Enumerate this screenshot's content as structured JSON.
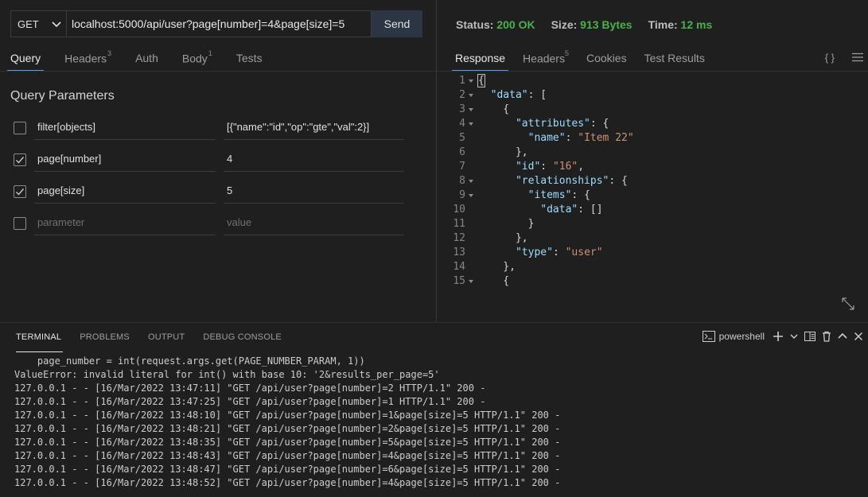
{
  "request": {
    "method": "GET",
    "url": "localhost:5000/api/user?page[number]=4&page[size]=5",
    "send_label": "Send",
    "tabs": [
      {
        "label": "Query",
        "count": ""
      },
      {
        "label": "Headers",
        "count": "3"
      },
      {
        "label": "Auth",
        "count": ""
      },
      {
        "label": "Body",
        "count": "1"
      },
      {
        "label": "Tests",
        "count": ""
      }
    ],
    "query_title": "Query Parameters",
    "params": [
      {
        "key": "filter[objects]",
        "value": "[{\"name\":\"id\",\"op\":\"gte\",\"val\":2}]",
        "checked": false
      },
      {
        "key": "page[number]",
        "value": "4",
        "checked": true
      },
      {
        "key": "page[size]",
        "value": "5",
        "checked": true
      }
    ],
    "new_param": {
      "key_placeholder": "parameter",
      "value_placeholder": "value"
    }
  },
  "response": {
    "status_label": "Status:",
    "status_value": "200 OK",
    "size_label": "Size:",
    "size_value": "913 Bytes",
    "time_label": "Time:",
    "time_value": "12 ms",
    "status_color": "#4caf50",
    "tabs": [
      {
        "label": "Response",
        "count": ""
      },
      {
        "label": "Headers",
        "count": "5"
      },
      {
        "label": "Cookies",
        "count": ""
      },
      {
        "label": "Test Results",
        "count": ""
      }
    ],
    "format_toggle": "{ }",
    "code_lines": [
      {
        "n": "1",
        "fold": true,
        "html": "<span class=\"cursor\">{</span>"
      },
      {
        "n": "2",
        "fold": true,
        "html": "  <span class=\"k\">\"data\"</span>: ["
      },
      {
        "n": "3",
        "fold": true,
        "html": "    {"
      },
      {
        "n": "4",
        "fold": true,
        "html": "      <span class=\"k\">\"attributes\"</span>: {"
      },
      {
        "n": "5",
        "fold": false,
        "html": "        <span class=\"k\">\"name\"</span>: <span class=\"s\">\"Item 22\"</span>"
      },
      {
        "n": "6",
        "fold": false,
        "html": "      },"
      },
      {
        "n": "7",
        "fold": false,
        "html": "      <span class=\"k\">\"id\"</span>: <span class=\"s\">\"16\"</span>,"
      },
      {
        "n": "8",
        "fold": true,
        "html": "      <span class=\"k\">\"relationships\"</span>: {"
      },
      {
        "n": "9",
        "fold": true,
        "html": "        <span class=\"k\">\"items\"</span>: {"
      },
      {
        "n": "10",
        "fold": false,
        "html": "          <span class=\"k\">\"data\"</span>: []"
      },
      {
        "n": "11",
        "fold": false,
        "html": "        }"
      },
      {
        "n": "12",
        "fold": false,
        "html": "      },"
      },
      {
        "n": "13",
        "fold": false,
        "html": "      <span class=\"k\">\"type\"</span>: <span class=\"s\">\"user\"</span>"
      },
      {
        "n": "14",
        "fold": false,
        "html": "    },"
      },
      {
        "n": "15",
        "fold": true,
        "html": "    {"
      }
    ]
  },
  "terminal": {
    "tabs": [
      "TERMINAL",
      "PROBLEMS",
      "OUTPUT",
      "DEBUG CONSOLE"
    ],
    "shell_label": "powershell",
    "lines": [
      "    page_number = int(request.args.get(PAGE_NUMBER_PARAM, 1))",
      "ValueError: invalid literal for int() with base 10: '2&results_per_page=5'",
      "127.0.0.1 - - [16/Mar/2022 13:47:11] \"GET /api/user?page[number]=2 HTTP/1.1\" 200 -",
      "127.0.0.1 - - [16/Mar/2022 13:47:25] \"GET /api/user?page[number]=1 HTTP/1.1\" 200 -",
      "127.0.0.1 - - [16/Mar/2022 13:48:10] \"GET /api/user?page[number]=1&page[size]=5 HTTP/1.1\" 200 -",
      "127.0.0.1 - - [16/Mar/2022 13:48:21] \"GET /api/user?page[number]=2&page[size]=5 HTTP/1.1\" 200 -",
      "127.0.0.1 - - [16/Mar/2022 13:48:35] \"GET /api/user?page[number]=5&page[size]=5 HTTP/1.1\" 200 -",
      "127.0.0.1 - - [16/Mar/2022 13:48:43] \"GET /api/user?page[number]=4&page[size]=5 HTTP/1.1\" 200 -",
      "127.0.0.1 - - [16/Mar/2022 13:48:47] \"GET /api/user?page[number]=6&page[size]=5 HTTP/1.1\" 200 -",
      "127.0.0.1 - - [16/Mar/2022 13:48:52] \"GET /api/user?page[number]=4&page[size]=5 HTTP/1.1\" 200 -"
    ]
  }
}
